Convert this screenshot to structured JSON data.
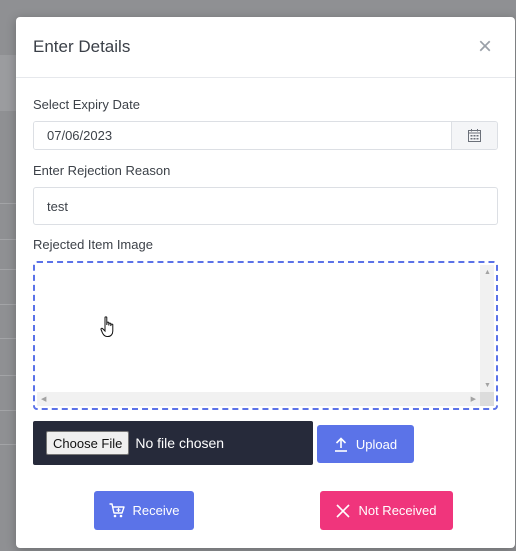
{
  "modal": {
    "title": "Enter Details",
    "close_icon": "close-icon"
  },
  "expiry": {
    "label": "Select Expiry Date",
    "value": "07/06/2023",
    "icon": "calendar-icon"
  },
  "reason": {
    "label": "Enter Rejection Reason",
    "value": "test"
  },
  "image": {
    "label": "Rejected Item Image",
    "file_button": "Choose File",
    "file_status": "No file chosen"
  },
  "actions": {
    "upload_label": "Upload",
    "receive_label": "Receive",
    "not_received_label": "Not Received"
  },
  "colors": {
    "primary": "#5b73e8",
    "danger": "#f0357c",
    "file_box": "#262a3a"
  }
}
